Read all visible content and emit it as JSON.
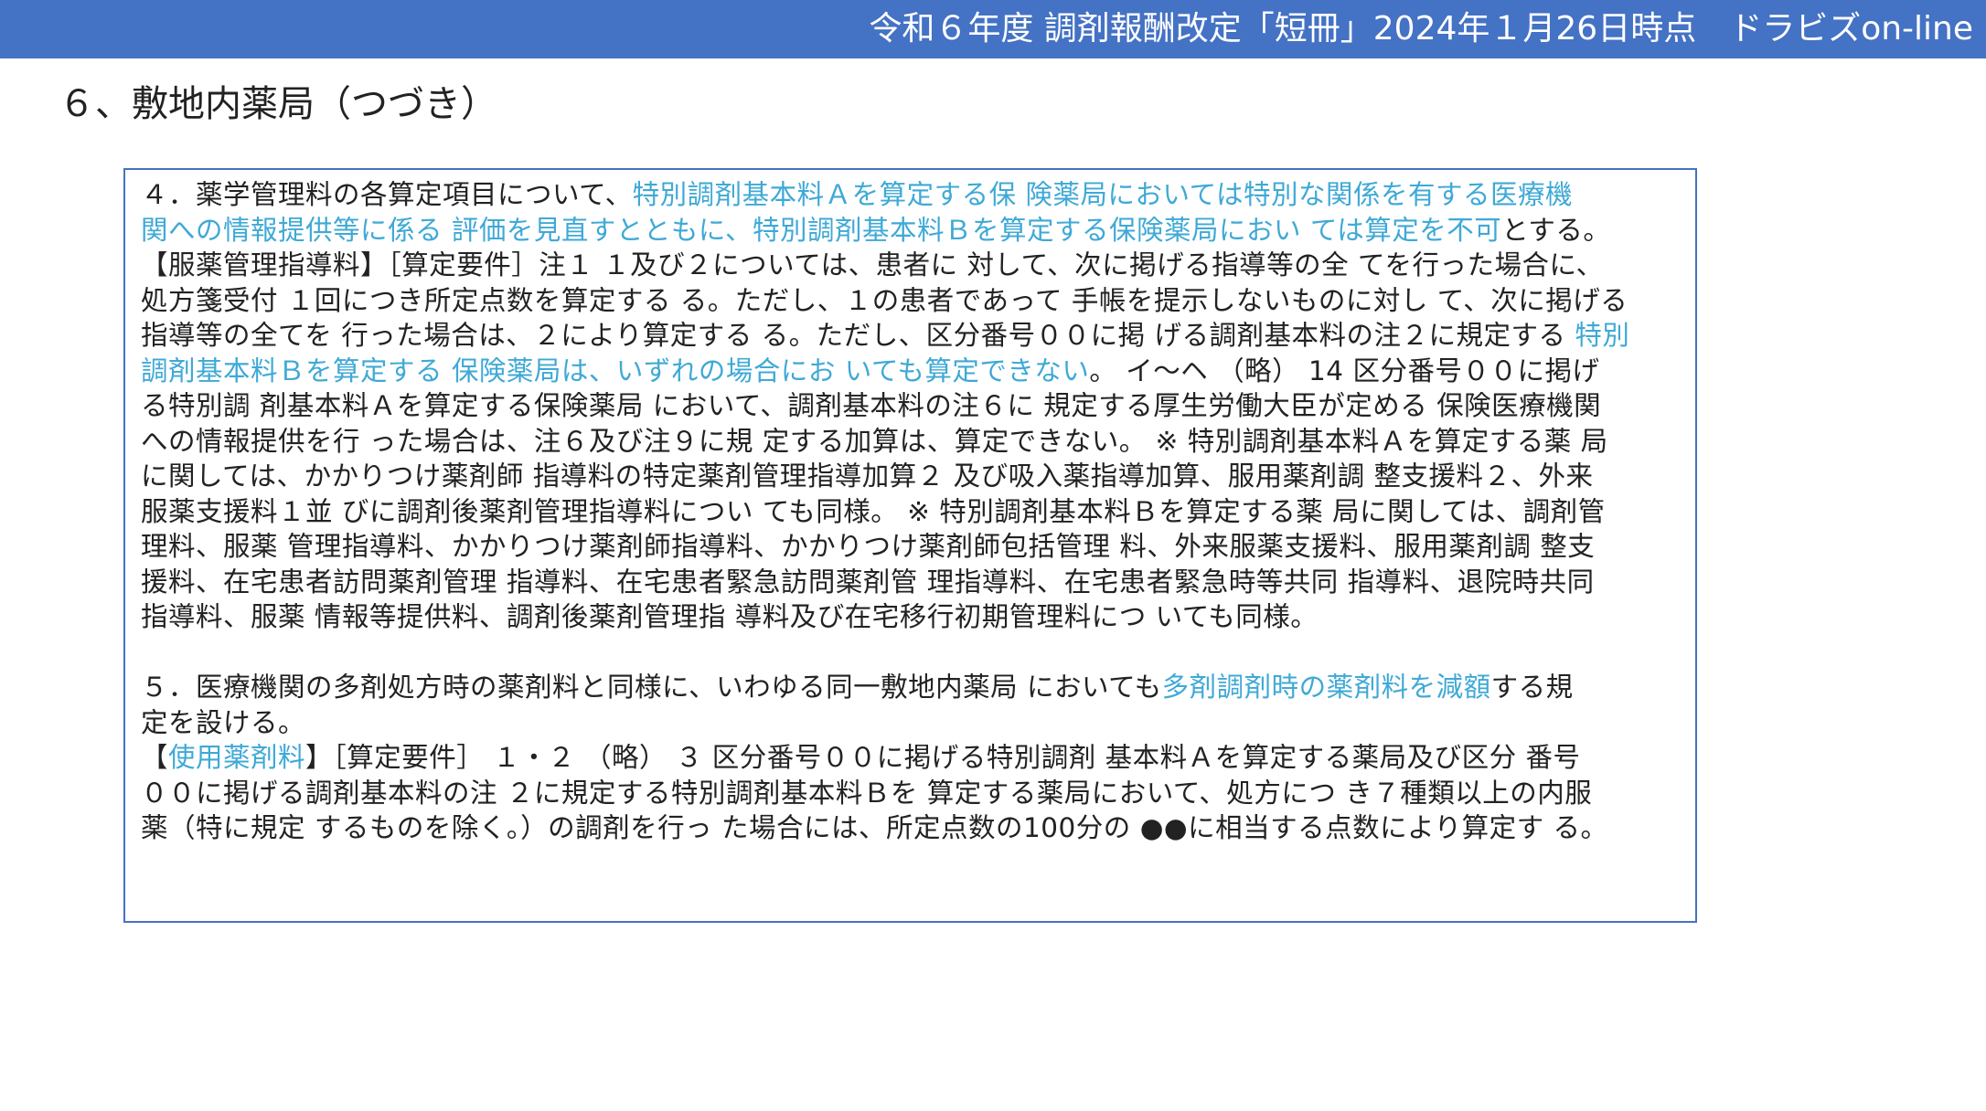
{
  "header": {
    "title": "令和６年度 調剤報酬改定「短冊」2024年１月26日時点　ドラビズon-line"
  },
  "section_title": "６、敷地内薬局（つづき）",
  "highlight_color": "#3fa9d6",
  "brand_color": "#4472c4",
  "item4": {
    "lines": [
      [
        {
          "t": "４．薬学管理料の各算定項目について、"
        },
        {
          "t": "特別調剤基本料Ａを算定する保 険薬局においては特別な関係を有する医療機",
          "hl": true
        }
      ],
      [
        {
          "t": "関への情報提供等に係る 評価を見直すとともに、特別調剤基本料Ｂを算定する保険薬局におい ては算定を不可",
          "hl": true
        },
        {
          "t": "とする。"
        }
      ],
      [
        {
          "t": "【服薬管理指導料】［算定要件］注１ １及び２については、患者に 対して、次に掲げる指導等の全 てを行った場合に、"
        }
      ],
      [
        {
          "t": "処方箋受付 １回につき所定点数を算定する る。ただし、１の患者であって 手帳を提示しないものに対し て、次に掲げる"
        }
      ],
      [
        {
          "t": "指導等の全てを 行った場合は、２により算定する る。ただし、区分番号００に掲 げる調剤基本料の注２に規定する "
        },
        {
          "t": "特別",
          "hl": true
        }
      ],
      [
        {
          "t": "調剤基本料Ｂを算定する 保険薬局は、いずれの場合にお いても算定できない",
          "hl": true
        },
        {
          "t": "。 イ〜ヘ （略） 14 区分番号００に掲げ"
        }
      ],
      [
        {
          "t": "る特別調 剤基本料Ａを算定する保険薬局 において、調剤基本料の注６に 規定する厚生労働大臣が定める 保険医療機関"
        }
      ],
      [
        {
          "t": "への情報提供を行 った場合は、注６及び注９に規 定する加算は、算定できない。 ※ 特別調剤基本料Ａを算定する薬 局"
        }
      ],
      [
        {
          "t": "に関しては、かかりつけ薬剤師 指導料の特定薬剤管理指導加算２ 及び吸入薬指導加算、服用薬剤調 整支援料２、外来"
        }
      ],
      [
        {
          "t": "服薬支援料１並 びに調剤後薬剤管理指導料につい ても同様。 ※ 特別調剤基本料Ｂを算定する薬 局に関しては、調剤管"
        }
      ],
      [
        {
          "t": "理料、服薬 管理指導料、かかりつけ薬剤師指導料、かかりつけ薬剤師包括管理 料、外来服薬支援料、服用薬剤調 整支"
        }
      ],
      [
        {
          "t": "援料、在宅患者訪問薬剤管理 指導料、在宅患者緊急訪問薬剤管 理指導料、在宅患者緊急時等共同 指導料、退院時共同"
        }
      ],
      [
        {
          "t": "指導料、服薬 情報等提供料、調剤後薬剤管理指 導料及び在宅移行初期管理料につ いても同様。"
        }
      ]
    ]
  },
  "item5": {
    "lines": [
      [
        {
          "t": "５．医療機関の多剤処方時の薬剤料と同様に、いわゆる同一敷地内薬局 においても"
        },
        {
          "t": "多剤調剤時の薬剤料を減額",
          "hl": true
        },
        {
          "t": "する規"
        }
      ],
      [
        {
          "t": "定を設ける。"
        }
      ],
      [
        {
          "t": "【"
        },
        {
          "t": "使用薬剤料",
          "hl": true
        },
        {
          "t": "】［算定要件］ １・２ （略） ３ 区分番号００に掲げる特別調剤 基本料Ａを算定する薬局及び区分 番号"
        }
      ],
      [
        {
          "t": "００に掲げる調剤基本料の注 ２に規定する特別調剤基本料Ｂを 算定する薬局において、処方につ き７種類以上の内服"
        }
      ],
      [
        {
          "t": "薬（特に規定 するものを除く。）の調剤を行っ た場合には、所定点数の100分の ●●に相当する点数により算定す る。"
        }
      ]
    ]
  }
}
